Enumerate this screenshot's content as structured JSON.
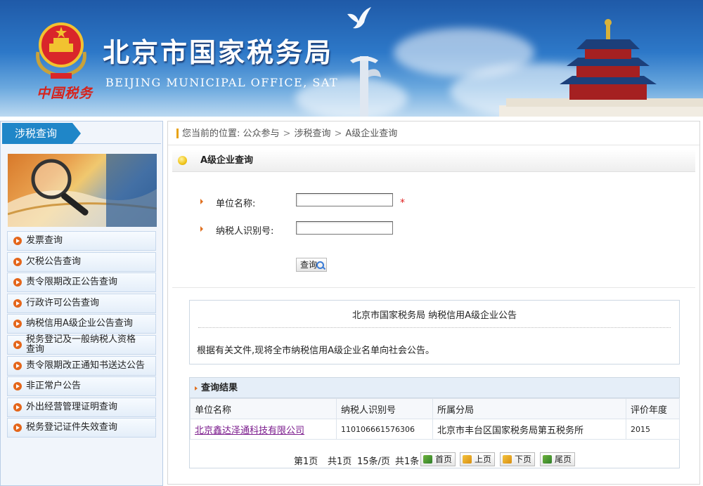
{
  "header": {
    "emblem_caption": "中国税务",
    "title_cn": "北京市国家税务局",
    "title_en": "BEIJING MUNICIPAL OFFICE, SAT"
  },
  "sidebar": {
    "tab_label": "涉税查询",
    "items": [
      {
        "label": "发票查询"
      },
      {
        "label": "欠税公告查询"
      },
      {
        "label": "责令限期改正公告查询"
      },
      {
        "label": "行政许可公告查询"
      },
      {
        "label": "纳税信用A级企业公告查询"
      },
      {
        "label": "税务登记及一般纳税人资格查询"
      },
      {
        "label": "责令限期改正通知书送达公告"
      },
      {
        "label": "非正常户公告"
      },
      {
        "label": "外出经营管理证明查询"
      },
      {
        "label": "税务登记证件失效查询"
      }
    ]
  },
  "breadcrumb": {
    "prefix": "您当前的位置:",
    "items": [
      "公众参与",
      "涉税查询",
      "A级企业查询"
    ]
  },
  "section": {
    "title": "A级企业查询"
  },
  "form": {
    "company_label": "单位名称:",
    "company_value": "",
    "required_mark": "*",
    "taxid_label": "纳税人识别号:",
    "taxid_value": "",
    "query_button": "查询"
  },
  "notice": {
    "title": "北京市国家税务局  纳税信用A级企业公告",
    "body": "根据有关文件,现将全市纳税信用A级企业名单向社会公告。"
  },
  "results": {
    "title": "查询结果",
    "columns": [
      "单位名称",
      "纳税人识别号",
      "所属分局",
      "评价年度"
    ],
    "rows": [
      [
        "北京鑫达泽通科技有限公司",
        "110106661576306",
        "北京市丰台区国家税务局第五税务所",
        "2015"
      ]
    ]
  },
  "pager": {
    "current": "第1页",
    "total_pages": "共1页",
    "per_page": "15条/页",
    "total_items": "共1条",
    "first": "首页",
    "prev": "上页",
    "next": "下页",
    "last": "尾页"
  }
}
